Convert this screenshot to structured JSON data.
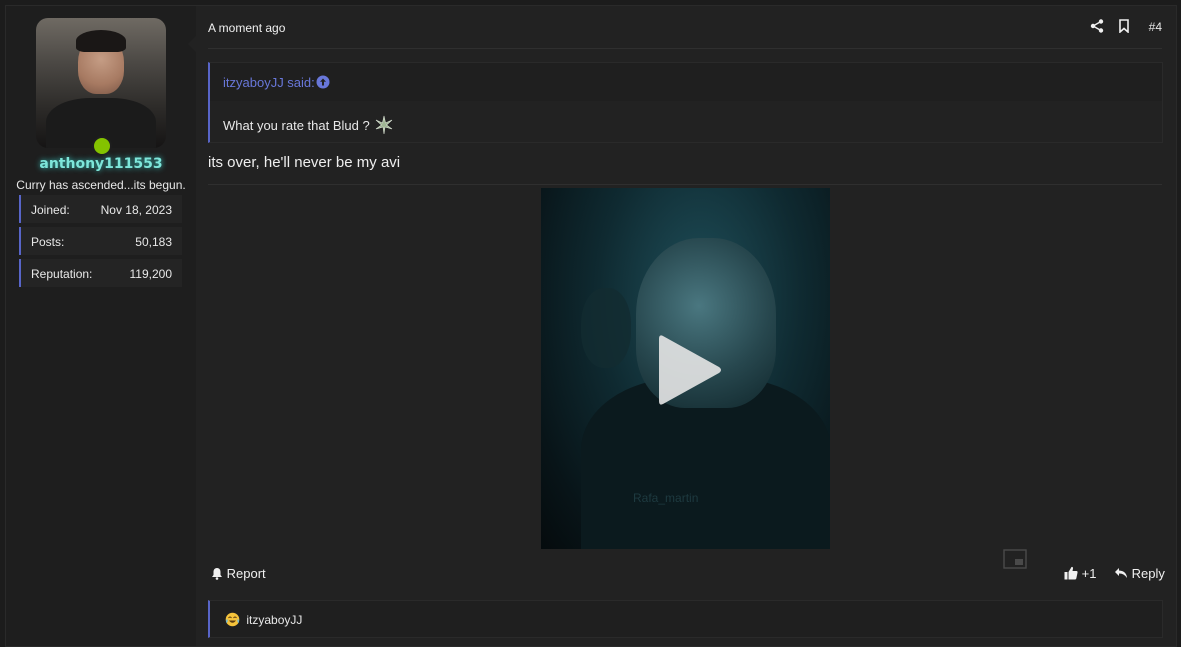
{
  "user": {
    "name": "anthony111553",
    "title": "Curry has ascended...its begun.",
    "stats": [
      {
        "label": "Joined:",
        "value": "Nov 18, 2023"
      },
      {
        "label": "Posts:",
        "value": "50,183"
      },
      {
        "label": "Reputation:",
        "value": "119,200"
      }
    ]
  },
  "post": {
    "timestamp": "A moment ago",
    "number": "#4",
    "quote": {
      "author": "itzyaboyJJ said:",
      "body": "What you rate that Blud ?"
    },
    "message": "its over, he'll never be my avi",
    "video": {
      "watermark": "Rafa_martin"
    },
    "actions": {
      "report": "Report",
      "like_count": "+1",
      "reply": "Reply"
    },
    "reactions": {
      "user": "itzyaboyJJ"
    }
  },
  "colors": {
    "accent": "#5865c8",
    "username": "#7ee6da",
    "online": "#84c300",
    "link": "#6877d9"
  }
}
